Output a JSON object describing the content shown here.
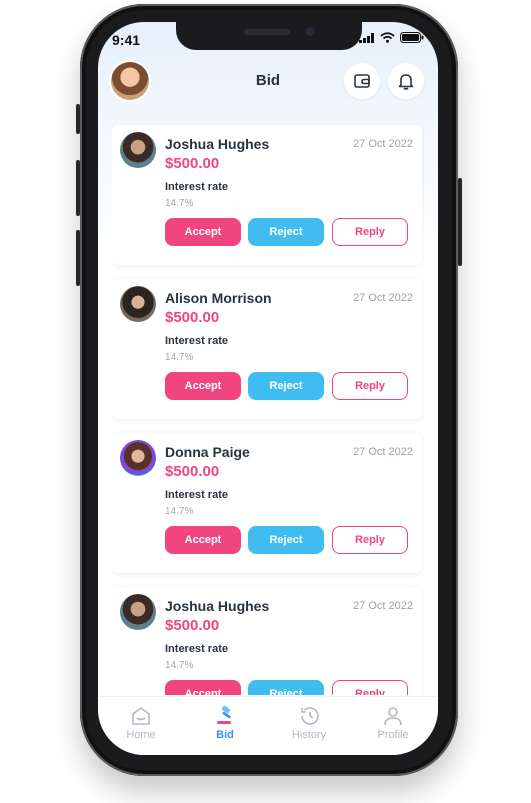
{
  "status": {
    "time": "9:41"
  },
  "header": {
    "title": "Bid"
  },
  "colors": {
    "accent": "#f0457f",
    "reject": "#3fbdf0",
    "active_tab": "#3a8fe8"
  },
  "bids": [
    {
      "name": "Joshua Hughes",
      "date": "27 Oct 2022",
      "amount": "$500.00",
      "rate_label": "Interest rate",
      "rate": "14.7%",
      "accept": "Accept",
      "reject": "Reject",
      "reply": "Reply"
    },
    {
      "name": "Alison Morrison",
      "date": "27 Oct 2022",
      "amount": "$500.00",
      "rate_label": "Interest rate",
      "rate": "14.7%",
      "accept": "Accept",
      "reject": "Reject",
      "reply": "Reply"
    },
    {
      "name": "Donna Paige",
      "date": "27 Oct 2022",
      "amount": "$500.00",
      "rate_label": "Interest rate",
      "rate": "14.7%",
      "accept": "Accept",
      "reject": "Reject",
      "reply": "Reply"
    },
    {
      "name": "Joshua Hughes",
      "date": "27 Oct 2022",
      "amount": "$500.00",
      "rate_label": "Interest rate",
      "rate": "14.7%",
      "accept": "Accept",
      "reject": "Reject",
      "reply": "Reply"
    }
  ],
  "tabs": [
    {
      "label": "Home",
      "icon": "home-icon"
    },
    {
      "label": "Bid",
      "icon": "gavel-icon",
      "active": true
    },
    {
      "label": "History",
      "icon": "history-icon"
    },
    {
      "label": "Profile",
      "icon": "profile-icon"
    }
  ]
}
